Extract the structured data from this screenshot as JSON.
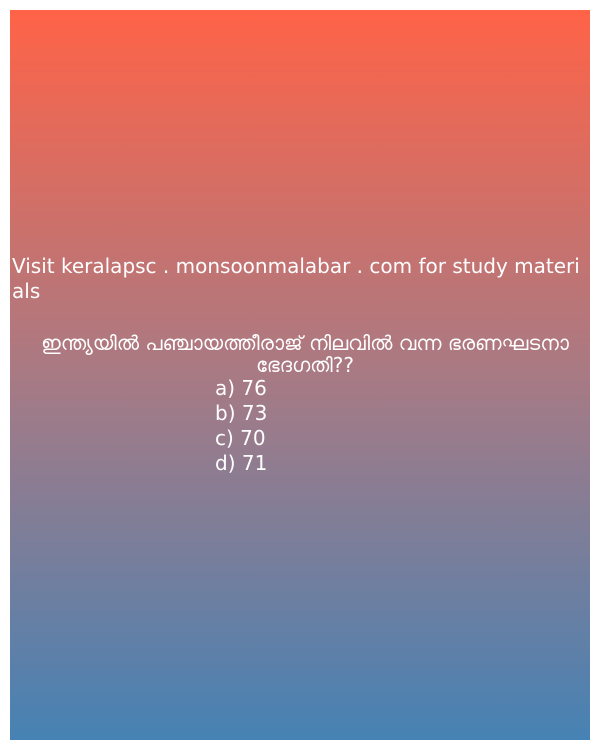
{
  "promo_text": "Visit keralapsc . monsoonmalabar . com for study materials",
  "question": "ഇന്ത്യയിൽ പഞ്ചായത്തീരാജ് നിലവിൽ വന്ന ഭരണഘടനാ ഭേദഗതി??",
  "options": [
    {
      "label": "a) 76"
    },
    {
      "label": "b) 73"
    },
    {
      "label": "c) 70"
    },
    {
      "label": "d) 71"
    }
  ],
  "colors": {
    "gradient_top": "#ff6347",
    "gradient_bottom": "#4682b4",
    "text": "#ffffff"
  }
}
